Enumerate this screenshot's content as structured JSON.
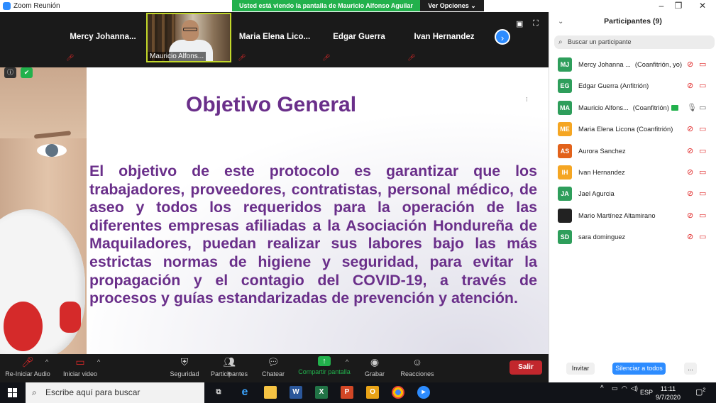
{
  "window": {
    "title": "Zoom Reunión",
    "banner": "Usted está viendo la pantalla de Mauricio Alfonso Aguilar",
    "view_options": "Ver Opciones"
  },
  "strip": {
    "tiles": [
      {
        "name": "Mercy  Johanna..."
      },
      {
        "name": "Mauricio Alfons..."
      },
      {
        "name": "Maria  Elena  Lico..."
      },
      {
        "name": "Edgar Guerra"
      },
      {
        "name": "Ivan Hernandez"
      }
    ]
  },
  "slide": {
    "title": "Objetivo General",
    "body": "El objetivo de este protocolo es garantizar que los trabajadores, proveedores, contratistas, personal médico, de aseo y todos los requeridos para la operación de las diferentes empresas afiliadas a la Asociación Hondureña de Maquiladores, puedan realizar sus labores bajo las más estrictas normas de higiene y seguridad, para evitar la propagación y el contagio del COVID-19, a través de procesos y guías estandarizadas de prevención y atención."
  },
  "toolbar": {
    "audio": "Re-Iniciar Audio",
    "video": "Iniciar video",
    "security": "Seguridad",
    "participants": "Participantes",
    "participants_count": "9",
    "chat": "Chatear",
    "share": "Compartir pantalla",
    "record": "Grabar",
    "reactions": "Reacciones",
    "leave": "Salir"
  },
  "panel": {
    "title": "Participantes (9)",
    "search_placeholder": "Buscar un participante",
    "participants": [
      {
        "initials": "MJ",
        "color": "#2e9e5b",
        "name": "Mercy Johanna ...",
        "role": "(Coanfitrión, yo)"
      },
      {
        "initials": "EG",
        "color": "#2e9e5b",
        "name": "Edgar Guerra (Anfitrión)",
        "role": ""
      },
      {
        "initials": "MA",
        "color": "#2e9e5b",
        "name": "Mauricio Alfons...",
        "role": "(Coanfitrión)"
      },
      {
        "initials": "ME",
        "color": "#f5a623",
        "name": "Maria Elena Licona (Coanfitrión)",
        "role": ""
      },
      {
        "initials": "AS",
        "color": "#e2621b",
        "name": "Aurora Sanchez",
        "role": ""
      },
      {
        "initials": "IH",
        "color": "#f5a623",
        "name": "Ivan Hernandez",
        "role": ""
      },
      {
        "initials": "JA",
        "color": "#2e9e5b",
        "name": "Jael Agurcia",
        "role": ""
      },
      {
        "initials": "",
        "color": "#222222",
        "name": "Mario Martínez Altamirano",
        "role": ""
      },
      {
        "initials": "SD",
        "color": "#2e9e5b",
        "name": "sara dominguez",
        "role": ""
      }
    ],
    "invite": "Invitar",
    "mute_all": "Silenciar a todos",
    "more": "..."
  },
  "taskbar": {
    "search_placeholder": "Escribe aquí para buscar",
    "lang": "ESP",
    "time": "11:11",
    "date": "9/7/2020",
    "notifications": "2"
  }
}
